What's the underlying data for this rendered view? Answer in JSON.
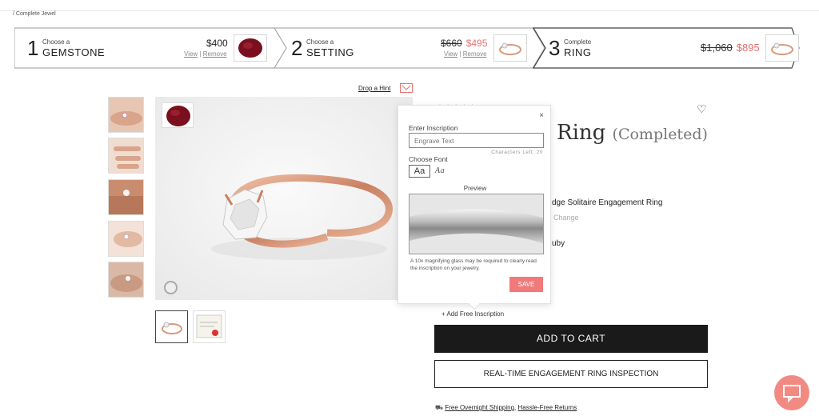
{
  "breadcrumb": "/ Complete Jewel",
  "steps": [
    {
      "num": "1",
      "small": "Choose a",
      "big": "GEMSTONE",
      "price": "$400",
      "view": "View",
      "sep": "|",
      "remove": "Remove"
    },
    {
      "num": "2",
      "small": "Choose a",
      "big": "SETTING",
      "old_price": "$660",
      "price": "$495",
      "view": "View",
      "sep": "|",
      "remove": "Remove"
    },
    {
      "num": "3",
      "small": "Complete",
      "big": "RING",
      "old_price": "$1,060",
      "price": "$895"
    }
  ],
  "hint": "Drop a Hint",
  "product": {
    "stars": "★★★★★",
    "title": "Ring",
    "title_sub": "(Completed)",
    "setting_name": "dge Solitaire Engagement Ring",
    "change": "Change",
    "gem_name": "uby"
  },
  "inscription_popup": {
    "close": "×",
    "enter_label": "Enter Inscription",
    "placeholder": "Engrave Text",
    "chars_left": "Characters Left: 20",
    "font_label": "Choose Font",
    "font_option_1": "Aa",
    "font_option_2": "Aa",
    "preview_label": "Preview",
    "note": "A 10x magnifying glass may be required to clearly read the inscription on your jewelry.",
    "save": "SAVE"
  },
  "add_inscription": "+ Add Free Inscription",
  "add_to_cart": "ADD TO CART",
  "inspection": "REAL-TIME ENGAGEMENT RING INSPECTION",
  "shipping": {
    "link1": "Free Overnight Shipping",
    "comma": ",",
    "link2": "Hassle-Free Returns"
  },
  "colors": {
    "accent": "#f07a7a",
    "sale": "#e87070",
    "cart_bg": "#1a1a1a",
    "ruby": "#7a0f1e",
    "rose_gold": "#d9987a"
  },
  "icons": [
    "heart-icon",
    "close-icon",
    "chat-icon",
    "hint-envelope-icon",
    "truck-icon",
    "zoom-icon"
  ]
}
